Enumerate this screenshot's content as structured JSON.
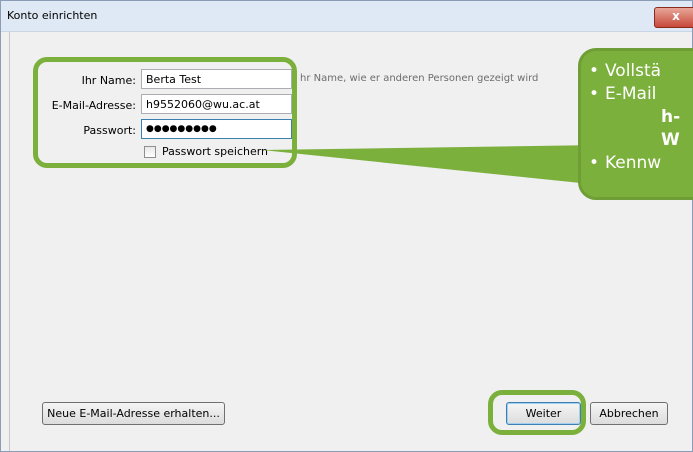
{
  "window": {
    "title": "Konto einrichten",
    "close_glyph": "x"
  },
  "form": {
    "name_label": "Ihr Name:",
    "name_value": "Berta Test",
    "name_hint": "hr Name, wie er anderen Personen gezeigt wird",
    "email_label": "E-Mail-Adresse:",
    "email_value": "h9552060@wu.ac.at",
    "password_label": "Passwort:",
    "password_value": "●●●●●●●●●",
    "remember_password_label": "Passwort speichern",
    "remember_password_checked": false
  },
  "buttons": {
    "new_email": "Neue E-Mail-Adresse erhalten...",
    "next": "Weiter",
    "cancel": "Abbrechen"
  },
  "callout": {
    "line1": "Vollstä",
    "line2": "E-Mail",
    "line3": "h-",
    "line4": "W",
    "line5": "Kennw"
  },
  "colors": {
    "callout_green": "#7cb03d",
    "titlebar": "#dfe9f5",
    "close_red": "#c7493a"
  }
}
